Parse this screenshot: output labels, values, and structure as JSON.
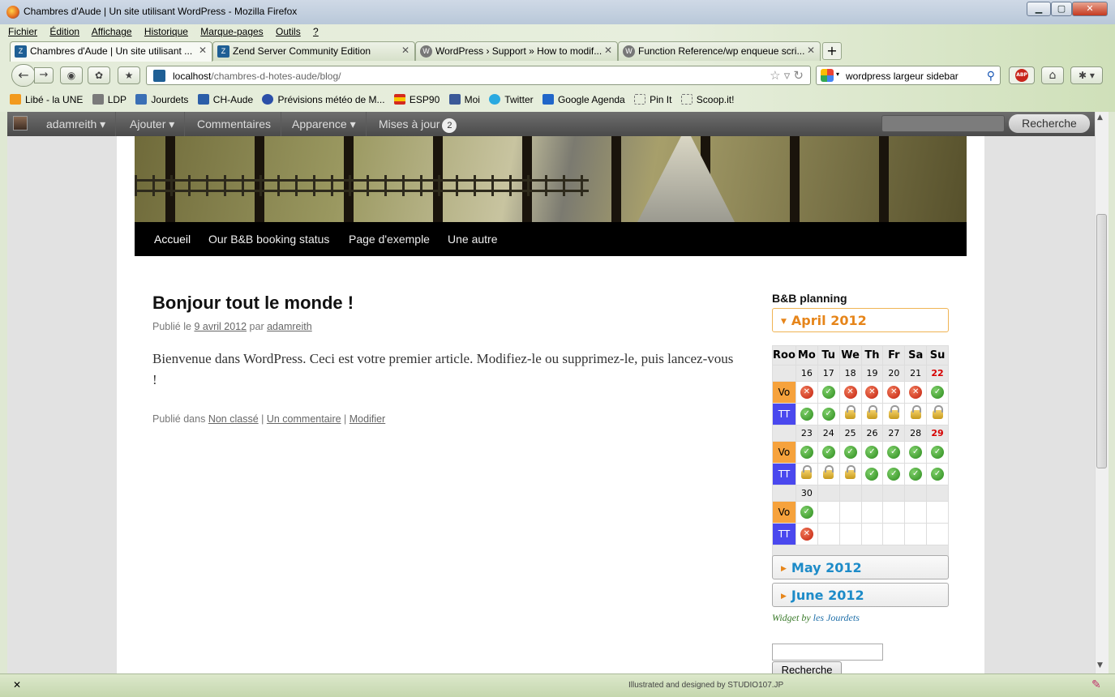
{
  "window": {
    "title": "Chambres d'Aude | Un site utilisant WordPress - Mozilla Firefox",
    "minimize": "▁",
    "maximize": "▢",
    "close": "✕"
  },
  "menu": [
    "Fichier",
    "Édition",
    "Affichage",
    "Historique",
    "Marque-pages",
    "Outils",
    "?"
  ],
  "tabs": [
    {
      "label": "Chambres d'Aude | Un site utilisant ...",
      "icon": "zend-icon",
      "active": true
    },
    {
      "label": "Zend Server Community Edition",
      "icon": "zend-icon",
      "active": false
    },
    {
      "label": "WordPress › Support » How to modif...",
      "icon": "wordpress-icon",
      "active": false
    },
    {
      "label": "Function Reference/wp enqueue scri...",
      "icon": "wordpress-icon",
      "active": false
    }
  ],
  "new_tab": "+",
  "url": {
    "host": "localhost",
    "path": "/chambres-d-hotes-aude/blog/"
  },
  "search": {
    "value": "wordpress largeur sidebar"
  },
  "bookmarks": [
    {
      "label": "Libé - la UNE",
      "icon": "rss-icon",
      "color": "#f29a1d"
    },
    {
      "label": "LDP",
      "icon": "pen-icon",
      "color": "#7a7a7a"
    },
    {
      "label": "Jourdets",
      "icon": "music-icon",
      "color": "#3a6fb5"
    },
    {
      "label": "CH-Aude",
      "icon": "person-icon",
      "color": "#2b5ea8"
    },
    {
      "label": "Prévisions météo de M...",
      "icon": "globe-icon",
      "color": "#2b4fa8"
    },
    {
      "label": "ESP90",
      "icon": "spain-flag-icon",
      "color": "#d42a1e"
    },
    {
      "label": "Moi",
      "icon": "facebook-icon",
      "color": "#3b5998"
    },
    {
      "label": "Twitter",
      "icon": "twitter-icon",
      "color": "#2aa9e0"
    },
    {
      "label": "Google Agenda",
      "icon": "calendar-icon",
      "color": "#2166c9"
    },
    {
      "label": "Pin It",
      "icon": "blank-page-icon",
      "color": "#ffffff"
    },
    {
      "label": "Scoop.it!",
      "icon": "blank-page-icon",
      "color": "#ffffff"
    }
  ],
  "adminbar": {
    "user": "adamreith ▾",
    "add": "Ajouter ▾",
    "comments": "Commentaires",
    "appearance": "Apparence ▾",
    "updates": "Mises à jour",
    "updates_count": "2",
    "search_button": "Recherche"
  },
  "site_nav": [
    "Accueil",
    "Our B&B booking status",
    "Page d'exemple",
    "Une autre"
  ],
  "post": {
    "title": "Bonjour tout le monde !",
    "meta_prefix": "Publié le",
    "date": "9 avril 2012",
    "meta_by": "par",
    "author": "adamreith",
    "body": "Bienvenue dans WordPress. Ceci est votre premier article. Modifiez-le ou supprimez-le, puis lancez-vous !",
    "footer_prefix": "Publié dans",
    "category": "Non classé",
    "comments": "Un commentaire",
    "edit": "Modifier"
  },
  "widget": {
    "title": "B&B planning",
    "months": [
      "April 2012",
      "May 2012",
      "June 2012"
    ],
    "calendar": {
      "headers": [
        "Roo",
        "Mo",
        "Tu",
        "We",
        "Th",
        "Fr",
        "Sa",
        "Su"
      ],
      "weeks": [
        {
          "days": [
            "16",
            "17",
            "18",
            "19",
            "20",
            "21",
            "22"
          ],
          "rooms": [
            {
              "name": "Vo",
              "status": [
                "no",
                "ok",
                "no",
                "no",
                "no",
                "no",
                "ok"
              ]
            },
            {
              "name": "TT",
              "status": [
                "ok",
                "ok",
                "lock",
                "lock",
                "lock",
                "lock",
                "lock"
              ]
            }
          ]
        },
        {
          "days": [
            "23",
            "24",
            "25",
            "26",
            "27",
            "28",
            "29"
          ],
          "rooms": [
            {
              "name": "Vo",
              "status": [
                "ok",
                "ok",
                "ok",
                "ok",
                "ok",
                "ok",
                "ok"
              ]
            },
            {
              "name": "TT",
              "status": [
                "lock",
                "lock",
                "lock",
                "ok",
                "ok",
                "ok",
                "ok"
              ]
            }
          ]
        },
        {
          "days": [
            "30",
            "",
            "",
            "",
            "",
            "",
            ""
          ],
          "rooms": [
            {
              "name": "Vo",
              "status": [
                "ok",
                "",
                "",
                "",
                "",
                "",
                ""
              ]
            },
            {
              "name": "TT",
              "status": [
                "no",
                "",
                "",
                "",
                "",
                "",
                ""
              ]
            }
          ]
        }
      ]
    },
    "credit_prefix": "Widget by",
    "credit_link": "les Jourdets",
    "search_button": "Recherche"
  },
  "statusbar": {
    "close": "✕",
    "credit": "Illustrated and designed by STUDIO107.JP"
  },
  "colors": {
    "room_vo": "#f6a23c",
    "room_tt": "#4a48ee",
    "accent_month": "#e6851a",
    "month_link": "#1d8bc8"
  }
}
